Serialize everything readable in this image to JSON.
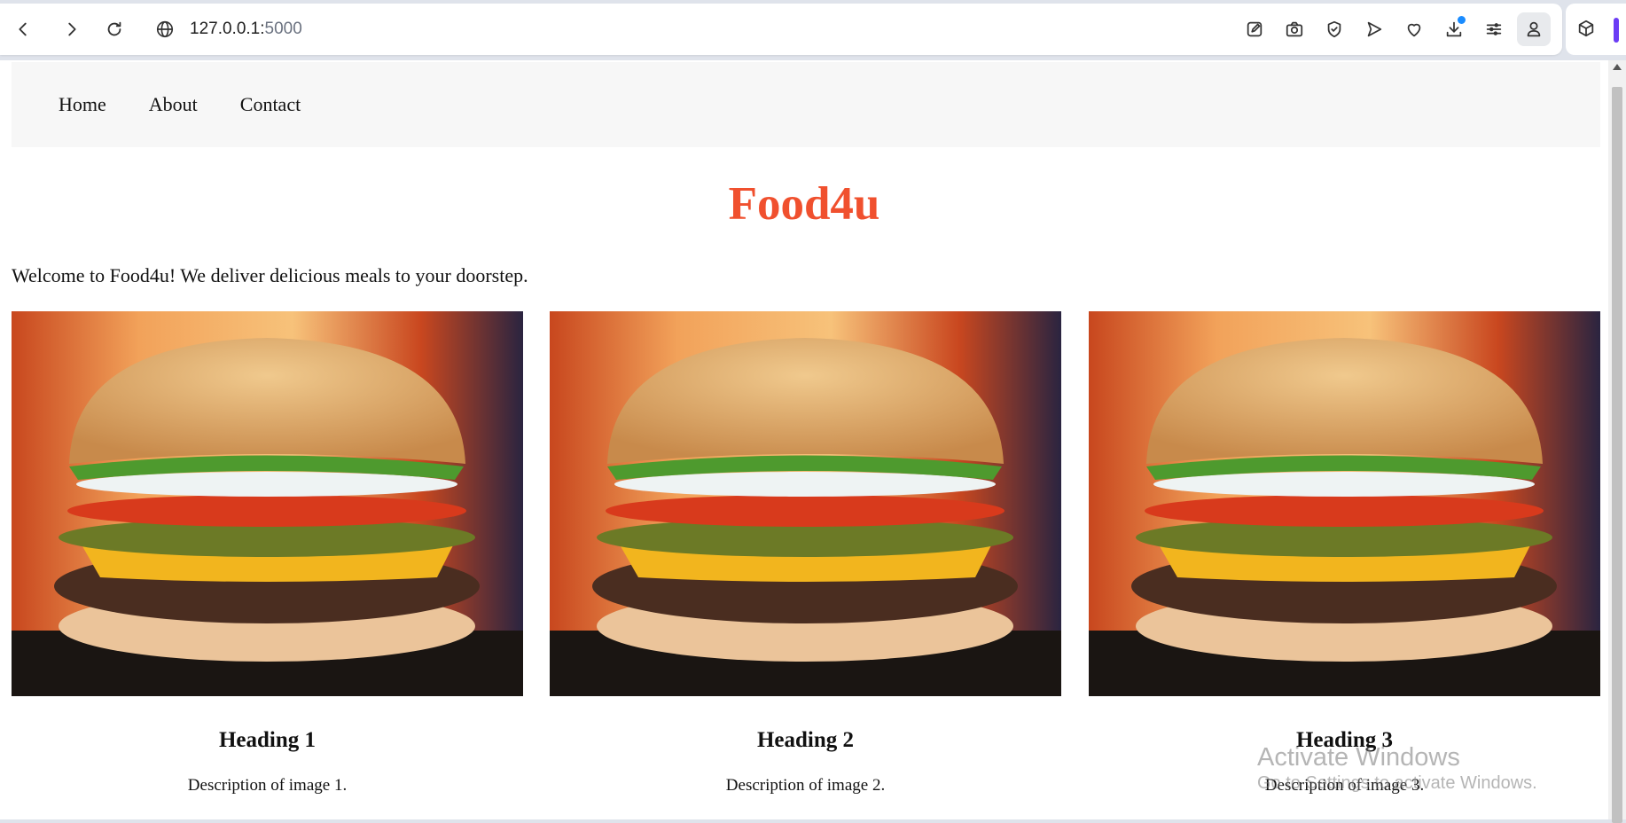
{
  "browser": {
    "url_host": "127.0.0.1:",
    "url_port": "5000"
  },
  "page": {
    "nav": [
      "Home",
      "About",
      "Contact"
    ],
    "title": "Food4u",
    "welcome": "Welcome to Food4u! We deliver delicious meals to your doorstep.",
    "cards": [
      {
        "heading": "Heading 1",
        "description": "Description of image 1."
      },
      {
        "heading": "Heading 2",
        "description": "Description of image 2."
      },
      {
        "heading": "Heading 3",
        "description": "Description of image 3."
      }
    ]
  },
  "watermark": {
    "line1": "Activate Windows",
    "line2": "Go to Settings to activate Windows."
  },
  "colors": {
    "title": "#f0502e",
    "navbar_bg": "#f7f7f7",
    "extension_accent": "#6b3cf5",
    "download_badge": "#1a8cff"
  }
}
